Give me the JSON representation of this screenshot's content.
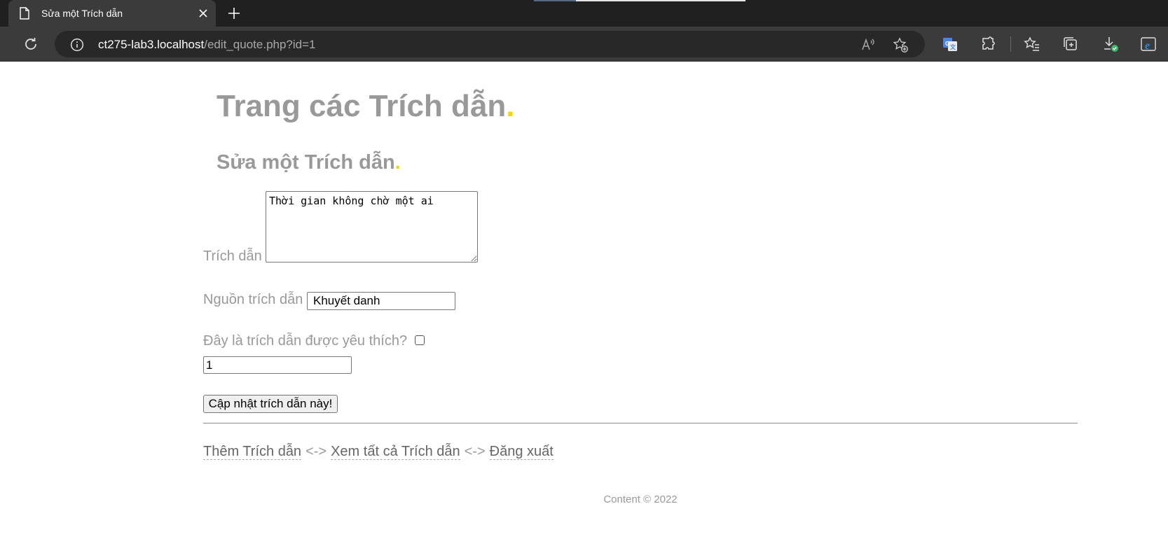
{
  "browser": {
    "tab_title": "Sửa một Trích dẫn",
    "url_host": "ct275-lab3.localhost",
    "url_path": "/edit_quote.php?id=1"
  },
  "page": {
    "site_title": "Trang các Trích dẫn",
    "heading": "Sửa một Trích dẫn",
    "title_dot": "."
  },
  "form": {
    "quote_label": "Trích dẫn",
    "quote_value": "Thời gian không chờ một ai",
    "source_label": "Nguồn trích dẫn",
    "source_value": "Khuyết danh",
    "favorite_label": "Đây là trích dẫn được yêu thích?",
    "favorite_checked": false,
    "id_value": "1",
    "submit_label": "Cập nhật trích dẫn này!"
  },
  "nav": {
    "add_quote": "Thêm Trích dẫn",
    "separator": "<->",
    "view_all": "Xem tất cả Trích dẫn",
    "logout": "Đăng xuất"
  },
  "footer": {
    "copyright": "Content © 2022"
  },
  "colors": {
    "accent_dot": "#f2d800",
    "text_gray": "#999999",
    "chrome_dark": "#202020"
  }
}
